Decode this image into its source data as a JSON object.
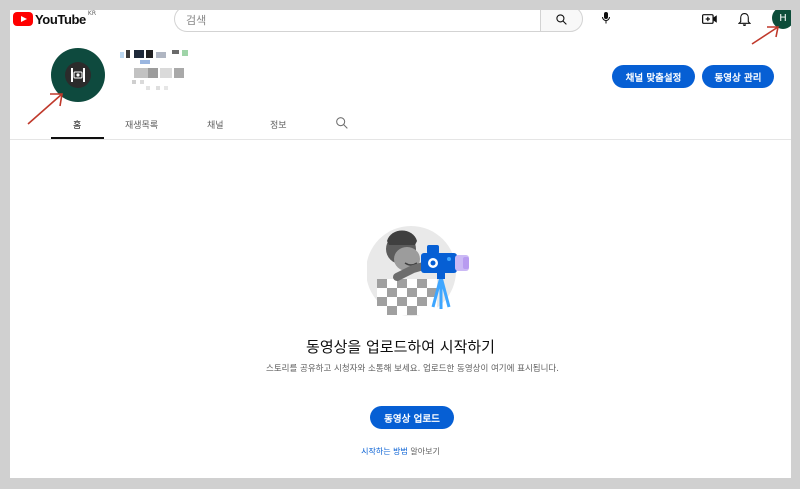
{
  "header": {
    "logo_text": "YouTube",
    "region": "KR",
    "search_placeholder": "검색",
    "avatar_letter": "H"
  },
  "channel": {
    "customize_label": "채널 맞춤설정",
    "manage_label": "동영상 관리"
  },
  "tabs": [
    {
      "label": "홈",
      "active": true
    },
    {
      "label": "재생목록",
      "active": false
    },
    {
      "label": "채널",
      "active": false
    },
    {
      "label": "정보",
      "active": false
    }
  ],
  "empty_state": {
    "title": "동영상을 업로드하여 시작하기",
    "description": "스토리를 공유하고 시청자와 소통해 보세요. 업로드한 동영상이 여기에 표시됩니다.",
    "upload_label": "동영상 업로드",
    "howto_link": "시작하는 방법",
    "howto_suffix": " 알아보기"
  },
  "colors": {
    "accent": "#065fd4",
    "brand_red": "#ff0000",
    "avatar_green": "#0d4d3a",
    "annotation": "#c0392b"
  }
}
